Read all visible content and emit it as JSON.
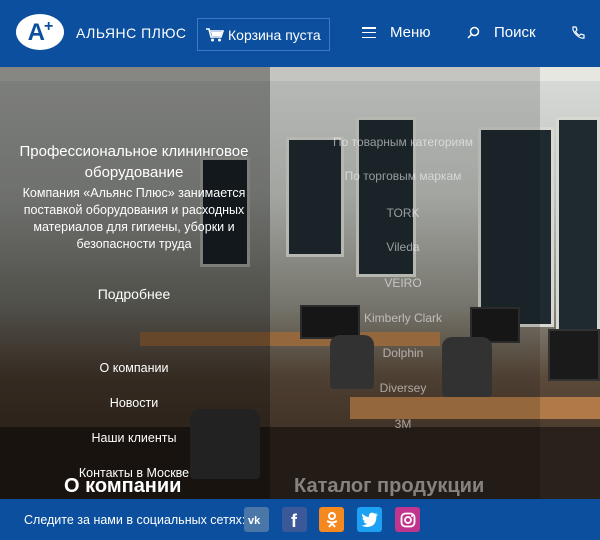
{
  "header": {
    "brand": "АЛЬЯНС ПЛЮС",
    "cart_label": "Корзина пуста",
    "menu_label": "Меню",
    "search_label": "Поиск"
  },
  "about": {
    "title": "Профессиональное клининговое оборудование",
    "text": "Компания «Альянс Плюс» занимается поставкой оборудования и расходных материалов для гигиены, уборки и безопасности труда",
    "more_label": "Подробнее",
    "nav": [
      "О компании",
      "Новости",
      "Наши клиенты",
      "Контакты в Москве"
    ],
    "section_title": "О компании"
  },
  "catalog": {
    "items": [
      "По товарным категориям",
      "По торговым маркам",
      "TORK",
      "Vileda",
      "VEIRO",
      "Kimberly Clark",
      "Dolphin",
      "Diversey",
      "3M"
    ],
    "section_title": "Каталог продукции"
  },
  "footer": {
    "follow_label": "Следите за нами в социальных сетях:",
    "socials": [
      {
        "name": "vk-icon",
        "color": "#4a76a8"
      },
      {
        "name": "facebook-icon",
        "color": "#3b5998"
      },
      {
        "name": "odnoklassniki-icon",
        "color": "#f5881f"
      },
      {
        "name": "twitter-icon",
        "color": "#1da1f2"
      },
      {
        "name": "instagram-icon",
        "color": "#c1358f"
      }
    ]
  },
  "colors": {
    "primary": "#0b4f9e"
  }
}
